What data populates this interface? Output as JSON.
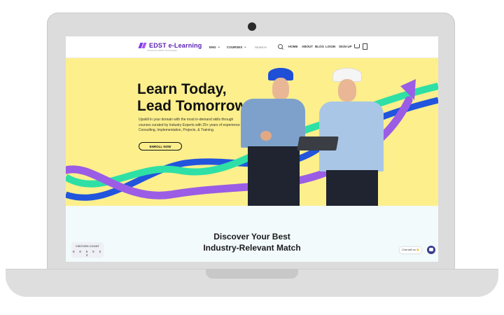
{
  "nav": {
    "logo": "EDST e-Learning",
    "logo_sub": "Powered by EDST Technologies",
    "items": [
      {
        "label": "ENG",
        "dropdown": true
      },
      {
        "label": "COURSES",
        "dropdown": true
      },
      {
        "label": "HOME"
      },
      {
        "label": "ABOUT"
      },
      {
        "label": "BLOG"
      },
      {
        "label": "LOGIN"
      },
      {
        "label": "SIGN UP"
      }
    ],
    "search_placeholder": "SEARCH"
  },
  "hero": {
    "title_line1": "Learn Today,",
    "title_line2": "Lead Tomorrow!",
    "description": "Upskill in your domain with the most in-demand skills through courses curated by Industry Experts with 25+ years of experience in Consulting, Implementation, Projects, & Training.",
    "cta": "ENROLL NOW"
  },
  "section": {
    "title_line1": "Discover Your Best",
    "title_line2": "Industry-Relevant Match"
  },
  "visitors": {
    "label": "VISITORS COUNT",
    "count": "0 0 6 9 5 3"
  },
  "chat": {
    "label": "Chat with us 👋"
  },
  "colors": {
    "hero_bg": "#fdef8c",
    "purple_arrow": "#9b5de5",
    "green_wave": "#2ee0a5",
    "blue_wave": "#2255dd",
    "logo": "#5b21b6"
  },
  "icons": [
    "search-icon",
    "cart-icon",
    "bookmark-icon",
    "chevron-down-icon",
    "chat-icon",
    "camera-icon"
  ]
}
